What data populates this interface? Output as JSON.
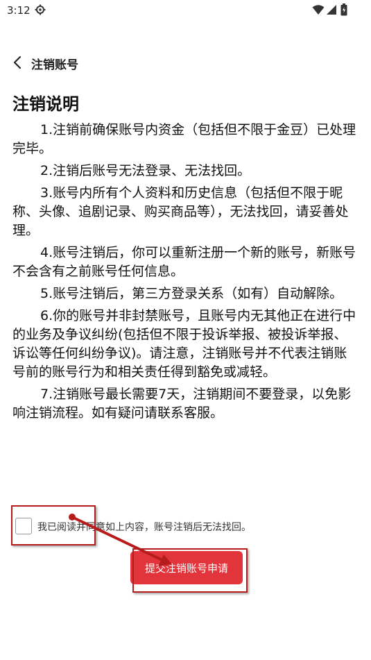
{
  "status_bar": {
    "time": "3:12",
    "icons": [
      "gear-icon",
      "wifi-icon",
      "signal-icon",
      "battery-icon"
    ]
  },
  "header": {
    "back_icon": "chevron-left-icon",
    "title": "注销账号"
  },
  "content": {
    "section_title": "注销说明",
    "items": [
      "1.注销前确保账号内资金（包括但不限于金豆）已处理完毕。",
      "2.注销后账号无法登录、无法找回。",
      "3.账号内所有个人资料和历史信息（包括但不限于昵称、头像、追剧记录、购买商品等），无法找回，请妥善处理。",
      "4.账号注销后，你可以重新注册一个新的账号，新账号不会含有之前账号任何信息。",
      "5.账号注销后，第三方登录关系（如有）自动解除。",
      "6.你的账号并非封禁账号，且账号内无其他正在进行中的业务及争议纠纷(包括但不限于投诉举报、被投诉举报、诉讼等任何纠纷争议)。请注意，注销账号并不代表注销账号前的账号行为和相关责任得到豁免或减轻。",
      "7.注销账号最长需要7天，注销期间不要登录，以免影响注销流程。如有疑问请联系客服。"
    ]
  },
  "agreement": {
    "checked": false,
    "label": "我已阅读并同意如上内容，账号注销后无法找回。"
  },
  "submit": {
    "label": "提交注销账号申请"
  },
  "colors": {
    "accent": "#e2343b",
    "annotation": "#b71c1c"
  }
}
